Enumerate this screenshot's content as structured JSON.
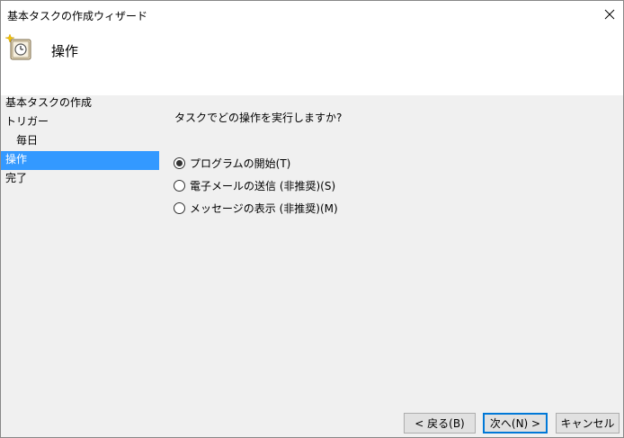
{
  "window": {
    "title": "基本タスクの作成ウィザード"
  },
  "header": {
    "title": "操作"
  },
  "nav": {
    "items": [
      {
        "label": "基本タスクの作成"
      },
      {
        "label": "トリガー"
      },
      {
        "label": "毎日"
      },
      {
        "label": "操作"
      },
      {
        "label": "完了"
      }
    ]
  },
  "main": {
    "question": "タスクでどの操作を実行しますか?",
    "options": [
      {
        "label": "プログラムの開始(T)",
        "selected": true
      },
      {
        "label": "電子メールの送信 (非推奨)(S)",
        "selected": false
      },
      {
        "label": "メッセージの表示 (非推奨)(M)",
        "selected": false
      }
    ]
  },
  "footer": {
    "back_label": "< 戻る(B)",
    "next_label": "次へ(N) >",
    "cancel_label": "キャンセル"
  },
  "colors": {
    "selection": "#3399ff",
    "default_button_border": "#0078d7"
  },
  "icons": {
    "header": "scheduled-task-clock-icon",
    "close": "close-icon"
  }
}
